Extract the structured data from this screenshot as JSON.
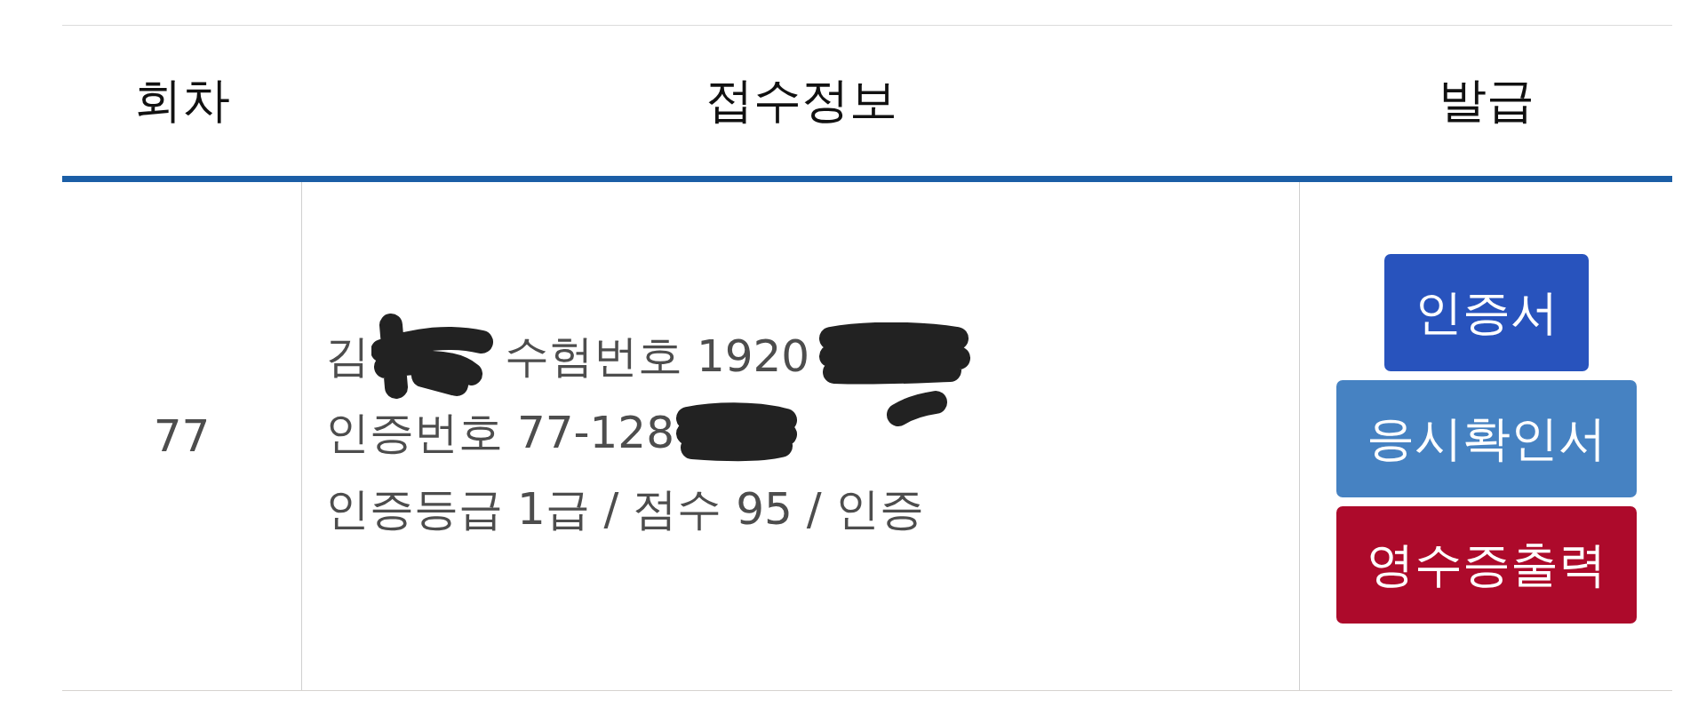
{
  "table": {
    "columns": [
      {
        "label": "회차"
      },
      {
        "label": "접수정보"
      },
      {
        "label": "발급"
      }
    ],
    "rows": [
      {
        "round": "77",
        "info_lines": [
          {
            "segments": [
              {
                "kind": "text",
                "text": "김"
              },
              {
                "kind": "redacted"
              },
              {
                "kind": "text",
                "text": "수험번호 1920"
              },
              {
                "kind": "redacted"
              }
            ]
          },
          {
            "segments": [
              {
                "kind": "text",
                "text": "인증번호 77-128"
              },
              {
                "kind": "redacted"
              }
            ]
          },
          {
            "segments": [
              {
                "kind": "text",
                "text": "인증등급 1급 / 점수 95 / 인증"
              }
            ]
          }
        ],
        "buttons": [
          {
            "label": "인증서",
            "color": "#2853bd"
          },
          {
            "label": "응시확인서",
            "color": "#4682c2"
          },
          {
            "label": "영수증출력",
            "color": "#ad0a2b"
          }
        ]
      }
    ]
  }
}
